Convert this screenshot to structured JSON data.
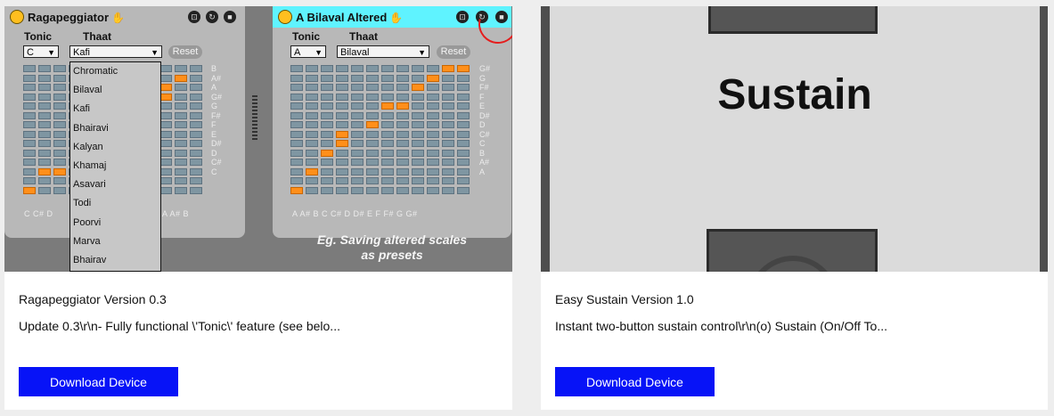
{
  "cards": [
    {
      "title": "Ragapeggiator Version 0.3",
      "description": "Update 0.3\\r\\n- Fully functional \\'Tonic\\' feature (see belo...",
      "button_label": "Download Device",
      "thumbnail": {
        "left_panel": {
          "title": "Ragapeggiator",
          "tonic_label": "Tonic",
          "thaat_label": "Thaat",
          "tonic_value": "C",
          "thaat_value": "Kafi",
          "reset_label": "Reset",
          "note_labels": [
            "B",
            "A#",
            "A",
            "G#",
            "G",
            "F#",
            "F",
            "E",
            "D#",
            "D",
            "C#",
            "C"
          ],
          "bottom_left": "C  C#  D",
          "bottom_right": "A  A#  B",
          "dropdown_options": [
            "Chromatic",
            "Bilaval",
            "Kafi",
            "Bhairavi",
            "Kalyan",
            "Khamaj",
            "Asavari",
            "Todi",
            "Poorvi",
            "Marva",
            "Bhairav"
          ]
        },
        "right_panel": {
          "title": "A Bilaval Altered",
          "tonic_label": "Tonic",
          "thaat_label": "Thaat",
          "tonic_value": "A",
          "thaat_value": "Bilaval",
          "reset_label": "Reset",
          "note_labels": [
            "G#",
            "G",
            "F#",
            "F",
            "E",
            "D#",
            "D",
            "C#",
            "C",
            "B",
            "A#",
            "A"
          ],
          "bottom_labels": "A  A#  B  C  C#  D  D#  E  F  F#  G  G#"
        },
        "caption_line1": "Eg. Saving altered scales",
        "caption_line2": "as presets"
      }
    },
    {
      "title": "Easy Sustain Version 1.0",
      "description": "Instant two-button sustain control\\r\\n(o) Sustain (On/Off To...",
      "button_label": "Download Device",
      "thumbnail": {
        "label": "Sustain"
      }
    }
  ],
  "colors": {
    "button_bg": "#0713f7",
    "active_cell": "#ff8f1a",
    "right_titlebar": "#5ff3ff",
    "led": "#ffbf1f"
  }
}
